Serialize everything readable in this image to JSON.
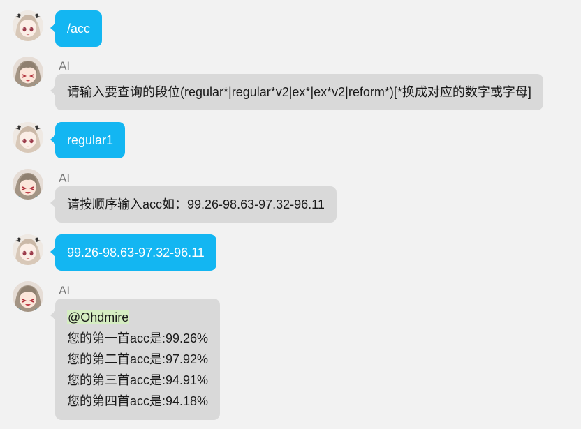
{
  "bot_name": "AI",
  "messages": [
    {
      "from": "user",
      "text": "/acc"
    },
    {
      "from": "bot",
      "text": "请输入要查询的段位(regular*|regular*v2|ex*|ex*v2|reform*)[*换成对应的数字或字母]"
    },
    {
      "from": "user",
      "text": "regular1"
    },
    {
      "from": "bot",
      "text": "请按顺序输入acc如：99.26-98.63-97.32-96.11"
    },
    {
      "from": "user",
      "text": "99.26-98.63-97.32-96.11"
    },
    {
      "from": "bot",
      "mention": "@Ohdmire",
      "lines": [
        "您的第一首acc是:99.26%",
        "您的第二首acc是:97.92%",
        "您的第三首acc是:94.91%",
        "您的第四首acc是:94.18%"
      ]
    }
  ],
  "colors": {
    "background": "#f2f2f2",
    "user_bubble": "#13b6f2",
    "bot_bubble": "#d9d9d9",
    "mention_highlight": "#d5edc2"
  },
  "icons": {
    "user_avatar": "user-avatar-anime-girl",
    "bot_avatar": "bot-avatar-anime-girl"
  }
}
